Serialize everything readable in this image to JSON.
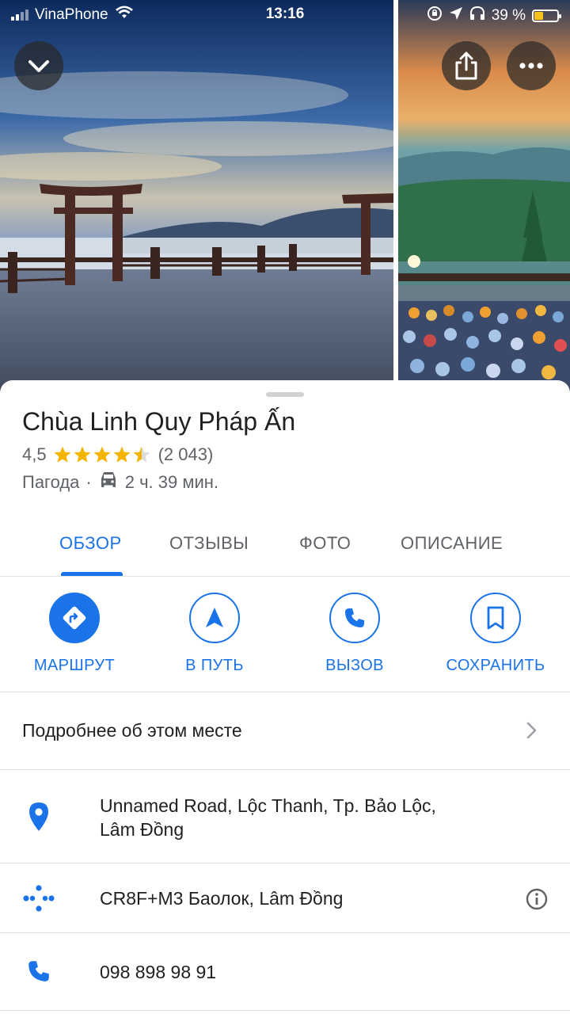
{
  "status_bar": {
    "carrier": "VinaPhone",
    "time": "13:16",
    "battery_percent": "39 %",
    "battery_level": 0.39,
    "battery_color": "#f4c21b"
  },
  "header": {
    "collapse_icon": "chevron-down-icon",
    "share_icon": "share-icon",
    "more_icon": "more-horizontal-icon"
  },
  "place": {
    "name": "Chùa Linh Quy Pháp Ấn",
    "rating": "4,5",
    "rating_value": 4.5,
    "rating_max": 5,
    "review_count": "(2 043)",
    "category": "Пагода",
    "separator": "·",
    "travel_time": "2 ч. 39 мин.",
    "star_color": "#f4b400"
  },
  "tabs": [
    {
      "label": "ОБЗОР",
      "active": true
    },
    {
      "label": "ОТЗЫВЫ",
      "active": false
    },
    {
      "label": "ФОТО",
      "active": false
    },
    {
      "label": "ОПИСАНИЕ",
      "active": false
    }
  ],
  "actions": [
    {
      "label": "МАРШРУТ",
      "icon": "directions-icon"
    },
    {
      "label": "В ПУТЬ",
      "icon": "navigation-arrow-icon"
    },
    {
      "label": "ВЫЗОВ",
      "icon": "phone-icon"
    },
    {
      "label": "СОХРАНИТЬ",
      "icon": "bookmark-icon"
    }
  ],
  "more_info": {
    "label": "Подробнее об этом месте"
  },
  "details": {
    "address_line1": "Unnamed Road, Lộc Thanh, Tp. Bảo Lộc,",
    "address_line2": "Lâm Đồng",
    "plus_code": "CR8F+M3 Баолок, Lâm Đồng",
    "phone": "098 898 98 91"
  },
  "colors": {
    "accent": "#1a73e8",
    "text_primary": "#202124",
    "text_secondary": "#5f6368"
  }
}
